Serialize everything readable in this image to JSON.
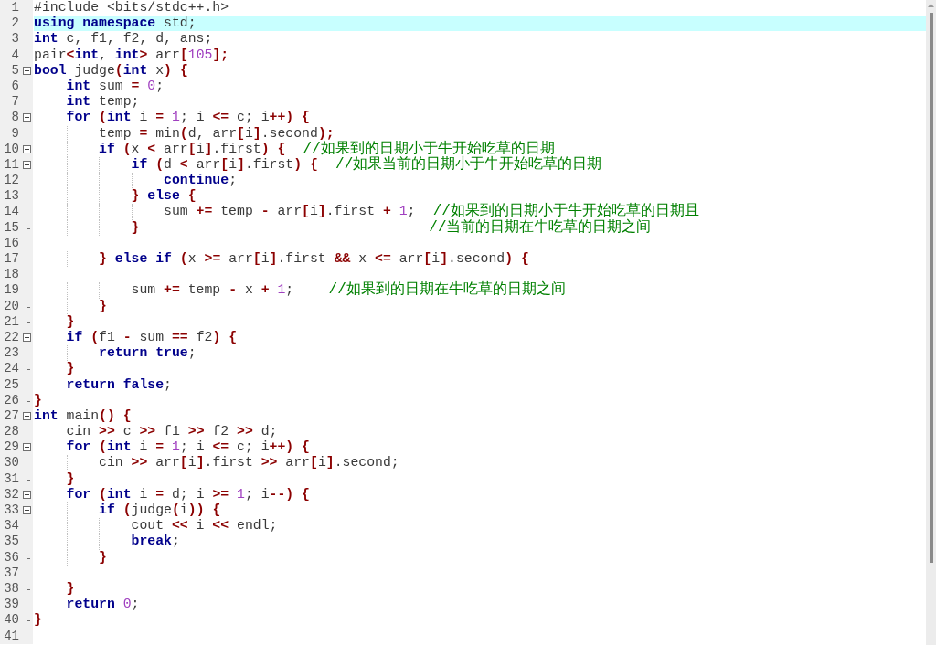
{
  "lines": [
    {
      "number": "1",
      "current": false,
      "kind": "plain",
      "tokens": [
        {
          "kind": "tx",
          "text": "#include <bits/stdc++.h>"
        }
      ]
    },
    {
      "number": "2",
      "current": true,
      "kind": "plain",
      "tokens": [
        {
          "kind": "kw",
          "text": "using"
        },
        {
          "kind": "kw",
          "text": " namespace"
        },
        {
          "kind": "tx",
          "text": " std;"
        }
      ]
    },
    {
      "number": "3",
      "current": false,
      "kind": "plain",
      "tokens": [
        {
          "kind": "kw",
          "text": "int"
        },
        {
          "kind": "tx",
          "text": " c, f1, f2, d, ans;"
        }
      ]
    },
    {
      "number": "4",
      "current": false,
      "kind": "plain",
      "tokens": [
        {
          "kind": "tx",
          "text": "pair"
        },
        {
          "kind": "op",
          "text": "<"
        },
        {
          "kind": "kw",
          "text": "int"
        },
        {
          "kind": "tx",
          "text": ", "
        },
        {
          "kind": "kw",
          "text": "int"
        },
        {
          "kind": "op",
          "text": ">"
        },
        {
          "kind": "tx",
          "text": " arr"
        },
        {
          "kind": "op",
          "text": "["
        },
        {
          "kind": "num",
          "text": "105"
        },
        {
          "kind": "op",
          "text": "];"
        }
      ]
    },
    {
      "number": "5",
      "current": false,
      "kind": "start",
      "tokens": [
        {
          "kind": "kw",
          "text": "bool"
        },
        {
          "kind": "tx",
          "text": " judge"
        },
        {
          "kind": "op",
          "text": "("
        },
        {
          "kind": "kw",
          "text": "int"
        },
        {
          "kind": "tx",
          "text": " x"
        },
        {
          "kind": "op",
          "text": ")"
        },
        {
          "kind": "op",
          "text": " {"
        }
      ]
    },
    {
      "number": "6",
      "current": false,
      "kind": "inside",
      "tokens": [
        {
          "kind": "kw",
          "text": "    int"
        },
        {
          "kind": "tx",
          "text": " sum "
        },
        {
          "kind": "op",
          "text": "="
        },
        {
          "kind": "num",
          "text": " 0"
        },
        {
          "kind": "tx",
          "text": ";"
        }
      ]
    },
    {
      "number": "7",
      "current": false,
      "kind": "inside",
      "tokens": [
        {
          "kind": "kw",
          "text": "    int"
        },
        {
          "kind": "tx",
          "text": " temp;"
        }
      ]
    },
    {
      "number": "8",
      "current": false,
      "kind": "start",
      "tokens": [
        {
          "kind": "kw",
          "text": "    for"
        },
        {
          "kind": "op",
          "text": " ("
        },
        {
          "kind": "kw",
          "text": "int"
        },
        {
          "kind": "tx",
          "text": " i "
        },
        {
          "kind": "op",
          "text": "="
        },
        {
          "kind": "num",
          "text": " 1"
        },
        {
          "kind": "tx",
          "text": "; i "
        },
        {
          "kind": "op",
          "text": "<="
        },
        {
          "kind": "tx",
          "text": " c; i"
        },
        {
          "kind": "op",
          "text": "++)"
        },
        {
          "kind": "op",
          "text": " {"
        }
      ]
    },
    {
      "number": "9",
      "current": false,
      "kind": "inside",
      "tokens": [
        {
          "kind": "tx",
          "text": "        temp "
        },
        {
          "kind": "op",
          "text": "="
        },
        {
          "kind": "tx",
          "text": " min"
        },
        {
          "kind": "op",
          "text": "("
        },
        {
          "kind": "tx",
          "text": "d, arr"
        },
        {
          "kind": "op",
          "text": "["
        },
        {
          "kind": "tx",
          "text": "i"
        },
        {
          "kind": "op",
          "text": "]"
        },
        {
          "kind": "tx",
          "text": ".second"
        },
        {
          "kind": "op",
          "text": ");"
        }
      ]
    },
    {
      "number": "10",
      "current": false,
      "kind": "start",
      "tokens": [
        {
          "kind": "kw",
          "text": "        if"
        },
        {
          "kind": "op",
          "text": " ("
        },
        {
          "kind": "tx",
          "text": "x "
        },
        {
          "kind": "op",
          "text": "<"
        },
        {
          "kind": "tx",
          "text": " arr"
        },
        {
          "kind": "op",
          "text": "["
        },
        {
          "kind": "tx",
          "text": "i"
        },
        {
          "kind": "op",
          "text": "]"
        },
        {
          "kind": "tx",
          "text": ".first"
        },
        {
          "kind": "op",
          "text": ")"
        },
        {
          "kind": "op",
          "text": " {"
        },
        {
          "kind": "cm",
          "text": "  //如果到的日期小于牛开始吃草的日期"
        }
      ]
    },
    {
      "number": "11",
      "current": false,
      "kind": "start",
      "tokens": [
        {
          "kind": "kw",
          "text": "            if"
        },
        {
          "kind": "op",
          "text": " ("
        },
        {
          "kind": "tx",
          "text": "d "
        },
        {
          "kind": "op",
          "text": "<"
        },
        {
          "kind": "tx",
          "text": " arr"
        },
        {
          "kind": "op",
          "text": "["
        },
        {
          "kind": "tx",
          "text": "i"
        },
        {
          "kind": "op",
          "text": "]"
        },
        {
          "kind": "tx",
          "text": ".first"
        },
        {
          "kind": "op",
          "text": ")"
        },
        {
          "kind": "op",
          "text": " {"
        },
        {
          "kind": "cm",
          "text": "  //如果当前的日期小于牛开始吃草的日期"
        }
      ]
    },
    {
      "number": "12",
      "current": false,
      "kind": "inside",
      "tokens": [
        {
          "kind": "kw",
          "text": "                continue"
        },
        {
          "kind": "tx",
          "text": ";"
        }
      ]
    },
    {
      "number": "13",
      "current": false,
      "kind": "inside",
      "tokens": [
        {
          "kind": "op",
          "text": "            }"
        },
        {
          "kind": "kw",
          "text": " else"
        },
        {
          "kind": "op",
          "text": " {"
        }
      ]
    },
    {
      "number": "14",
      "current": false,
      "kind": "inside",
      "tokens": [
        {
          "kind": "tx",
          "text": "                sum "
        },
        {
          "kind": "op",
          "text": "+="
        },
        {
          "kind": "tx",
          "text": " temp "
        },
        {
          "kind": "op",
          "text": "-"
        },
        {
          "kind": "tx",
          "text": " arr"
        },
        {
          "kind": "op",
          "text": "["
        },
        {
          "kind": "tx",
          "text": "i"
        },
        {
          "kind": "op",
          "text": "]"
        },
        {
          "kind": "tx",
          "text": ".first "
        },
        {
          "kind": "op",
          "text": "+"
        },
        {
          "kind": "num",
          "text": " 1"
        },
        {
          "kind": "tx",
          "text": ";"
        },
        {
          "kind": "cm",
          "text": "  //如果到的日期小于牛开始吃草的日期且"
        }
      ]
    },
    {
      "number": "15",
      "current": false,
      "kind": "end",
      "tokens": [
        {
          "kind": "op",
          "text": "            }"
        },
        {
          "kind": "cm",
          "text": "                                 //当前的日期在牛吃草的日期之间"
        }
      ]
    },
    {
      "number": "16",
      "current": false,
      "kind": "inside"
    },
    {
      "number": "17",
      "current": false,
      "kind": "inside",
      "tokens": [
        {
          "kind": "op",
          "text": "        }"
        },
        {
          "kind": "kw",
          "text": " else"
        },
        {
          "kind": "kw",
          "text": " if"
        },
        {
          "kind": "op",
          "text": " ("
        },
        {
          "kind": "tx",
          "text": "x "
        },
        {
          "kind": "op",
          "text": ">="
        },
        {
          "kind": "tx",
          "text": " arr"
        },
        {
          "kind": "op",
          "text": "["
        },
        {
          "kind": "tx",
          "text": "i"
        },
        {
          "kind": "op",
          "text": "]"
        },
        {
          "kind": "tx",
          "text": ".first "
        },
        {
          "kind": "op",
          "text": "&&"
        },
        {
          "kind": "tx",
          "text": " x "
        },
        {
          "kind": "op",
          "text": "<="
        },
        {
          "kind": "tx",
          "text": " arr"
        },
        {
          "kind": "op",
          "text": "["
        },
        {
          "kind": "tx",
          "text": "i"
        },
        {
          "kind": "op",
          "text": "]"
        },
        {
          "kind": "tx",
          "text": ".second"
        },
        {
          "kind": "op",
          "text": ")"
        },
        {
          "kind": "op",
          "text": " {"
        }
      ]
    },
    {
      "number": "18",
      "current": false,
      "kind": "inside"
    },
    {
      "number": "19",
      "current": false,
      "kind": "inside",
      "tokens": [
        {
          "kind": "tx",
          "text": "            sum "
        },
        {
          "kind": "op",
          "text": "+="
        },
        {
          "kind": "tx",
          "text": " temp "
        },
        {
          "kind": "op",
          "text": "-"
        },
        {
          "kind": "tx",
          "text": " x "
        },
        {
          "kind": "op",
          "text": "+"
        },
        {
          "kind": "num",
          "text": " 1"
        },
        {
          "kind": "tx",
          "text": ";"
        },
        {
          "kind": "cm",
          "text": "    //如果到的日期在牛吃草的日期之间"
        }
      ]
    },
    {
      "number": "20",
      "current": false,
      "kind": "end",
      "tokens": [
        {
          "kind": "op",
          "text": "        }"
        }
      ]
    },
    {
      "number": "21",
      "current": false,
      "kind": "end",
      "tokens": [
        {
          "kind": "op",
          "text": "    }"
        }
      ]
    },
    {
      "number": "22",
      "current": false,
      "kind": "start",
      "tokens": [
        {
          "kind": "kw",
          "text": "    if"
        },
        {
          "kind": "op",
          "text": " ("
        },
        {
          "kind": "tx",
          "text": "f1 "
        },
        {
          "kind": "op",
          "text": "-"
        },
        {
          "kind": "tx",
          "text": " sum "
        },
        {
          "kind": "op",
          "text": "=="
        },
        {
          "kind": "tx",
          "text": " f2"
        },
        {
          "kind": "op",
          "text": ")"
        },
        {
          "kind": "op",
          "text": " {"
        }
      ]
    },
    {
      "number": "23",
      "current": false,
      "kind": "inside",
      "tokens": [
        {
          "kind": "kw",
          "text": "        return"
        },
        {
          "kind": "kw",
          "text": " true"
        },
        {
          "kind": "tx",
          "text": ";"
        }
      ]
    },
    {
      "number": "24",
      "current": false,
      "kind": "end",
      "tokens": [
        {
          "kind": "op",
          "text": "    }"
        }
      ]
    },
    {
      "number": "25",
      "current": false,
      "kind": "inside",
      "tokens": [
        {
          "kind": "kw",
          "text": "    return"
        },
        {
          "kind": "kw",
          "text": " false"
        },
        {
          "kind": "tx",
          "text": ";"
        }
      ]
    },
    {
      "number": "26",
      "current": false,
      "kind": "close",
      "tokens": [
        {
          "kind": "op",
          "text": "}"
        }
      ]
    },
    {
      "number": "27",
      "current": false,
      "kind": "start",
      "tokens": [
        {
          "kind": "kw",
          "text": "int"
        },
        {
          "kind": "tx",
          "text": " main"
        },
        {
          "kind": "op",
          "text": "()"
        },
        {
          "kind": "op",
          "text": " {"
        }
      ]
    },
    {
      "number": "28",
      "current": false,
      "kind": "inside",
      "tokens": [
        {
          "kind": "tx",
          "text": "    cin "
        },
        {
          "kind": "op",
          "text": ">>"
        },
        {
          "kind": "tx",
          "text": " c "
        },
        {
          "kind": "op",
          "text": ">>"
        },
        {
          "kind": "tx",
          "text": " f1 "
        },
        {
          "kind": "op",
          "text": ">>"
        },
        {
          "kind": "tx",
          "text": " f2 "
        },
        {
          "kind": "op",
          "text": ">>"
        },
        {
          "kind": "tx",
          "text": " d;"
        }
      ]
    },
    {
      "number": "29",
      "current": false,
      "kind": "start",
      "tokens": [
        {
          "kind": "kw",
          "text": "    for"
        },
        {
          "kind": "op",
          "text": " ("
        },
        {
          "kind": "kw",
          "text": "int"
        },
        {
          "kind": "tx",
          "text": " i "
        },
        {
          "kind": "op",
          "text": "="
        },
        {
          "kind": "num",
          "text": " 1"
        },
        {
          "kind": "tx",
          "text": "; i "
        },
        {
          "kind": "op",
          "text": "<="
        },
        {
          "kind": "tx",
          "text": " c; i"
        },
        {
          "kind": "op",
          "text": "++)"
        },
        {
          "kind": "op",
          "text": " {"
        }
      ]
    },
    {
      "number": "30",
      "current": false,
      "kind": "inside",
      "tokens": [
        {
          "kind": "tx",
          "text": "        cin "
        },
        {
          "kind": "op",
          "text": ">>"
        },
        {
          "kind": "tx",
          "text": " arr"
        },
        {
          "kind": "op",
          "text": "["
        },
        {
          "kind": "tx",
          "text": "i"
        },
        {
          "kind": "op",
          "text": "]"
        },
        {
          "kind": "tx",
          "text": ".first "
        },
        {
          "kind": "op",
          "text": ">>"
        },
        {
          "kind": "tx",
          "text": " arr"
        },
        {
          "kind": "op",
          "text": "["
        },
        {
          "kind": "tx",
          "text": "i"
        },
        {
          "kind": "op",
          "text": "]"
        },
        {
          "kind": "tx",
          "text": ".second;"
        }
      ]
    },
    {
      "number": "31",
      "current": false,
      "kind": "end",
      "tokens": [
        {
          "kind": "op",
          "text": "    }"
        }
      ]
    },
    {
      "number": "32",
      "current": false,
      "kind": "start",
      "tokens": [
        {
          "kind": "kw",
          "text": "    for"
        },
        {
          "kind": "op",
          "text": " ("
        },
        {
          "kind": "kw",
          "text": "int"
        },
        {
          "kind": "tx",
          "text": " i "
        },
        {
          "kind": "op",
          "text": "="
        },
        {
          "kind": "tx",
          "text": " d; i "
        },
        {
          "kind": "op",
          "text": ">="
        },
        {
          "kind": "num",
          "text": " 1"
        },
        {
          "kind": "tx",
          "text": "; i"
        },
        {
          "kind": "op",
          "text": "--)"
        },
        {
          "kind": "op",
          "text": " {"
        }
      ]
    },
    {
      "number": "33",
      "current": false,
      "kind": "start",
      "tokens": [
        {
          "kind": "kw",
          "text": "        if"
        },
        {
          "kind": "op",
          "text": " ("
        },
        {
          "kind": "tx",
          "text": "judge"
        },
        {
          "kind": "op",
          "text": "("
        },
        {
          "kind": "tx",
          "text": "i"
        },
        {
          "kind": "op",
          "text": "))"
        },
        {
          "kind": "op",
          "text": " {"
        }
      ]
    },
    {
      "number": "34",
      "current": false,
      "kind": "inside",
      "tokens": [
        {
          "kind": "tx",
          "text": "            cout "
        },
        {
          "kind": "op",
          "text": "<<"
        },
        {
          "kind": "tx",
          "text": " i "
        },
        {
          "kind": "op",
          "text": "<<"
        },
        {
          "kind": "tx",
          "text": " endl;"
        }
      ]
    },
    {
      "number": "35",
      "current": false,
      "kind": "inside",
      "tokens": [
        {
          "kind": "kw",
          "text": "            break"
        },
        {
          "kind": "tx",
          "text": ";"
        }
      ]
    },
    {
      "number": "36",
      "current": false,
      "kind": "end",
      "tokens": [
        {
          "kind": "op",
          "text": "        }"
        }
      ]
    },
    {
      "number": "37",
      "current": false,
      "kind": "inside"
    },
    {
      "number": "38",
      "current": false,
      "kind": "end",
      "tokens": [
        {
          "kind": "op",
          "text": "    }"
        }
      ]
    },
    {
      "number": "39",
      "current": false,
      "kind": "inside",
      "tokens": [
        {
          "kind": "kw",
          "text": "    return"
        },
        {
          "kind": "num",
          "text": " 0"
        },
        {
          "kind": "tx",
          "text": ";"
        }
      ]
    },
    {
      "number": "40",
      "current": false,
      "kind": "close",
      "tokens": [
        {
          "kind": "op",
          "text": "}"
        }
      ]
    },
    {
      "number": "41",
      "current": false,
      "kind": "plain"
    }
  ]
}
